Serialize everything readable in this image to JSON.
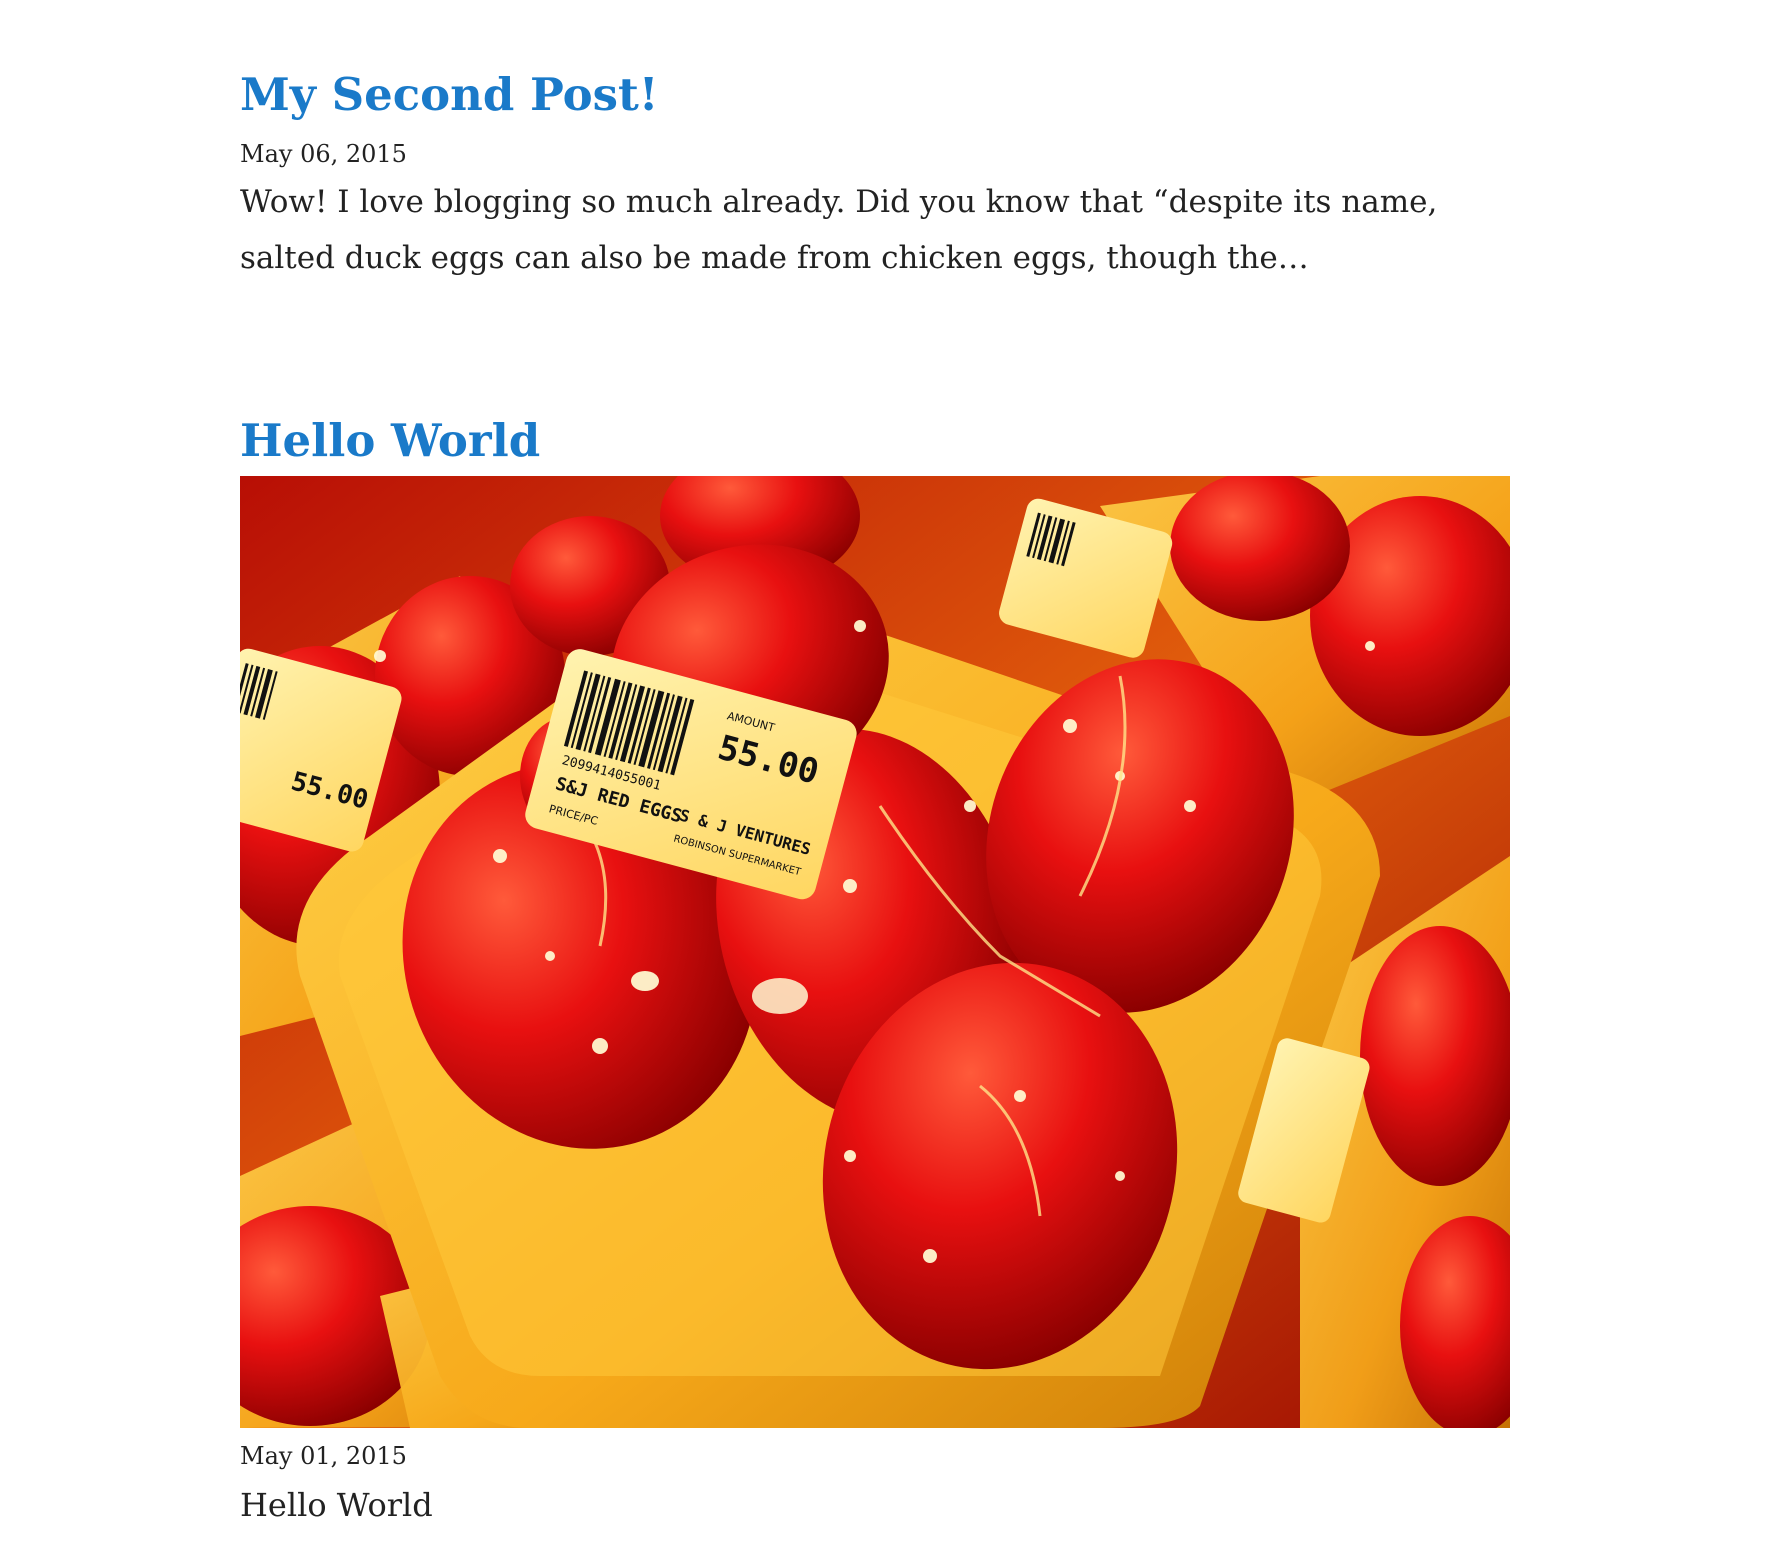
{
  "posts": [
    {
      "title": "My Second Post!",
      "date": "May 06, 2015",
      "excerpt": "Wow! I love blogging so much already. Did you know that “despite its name, salted duck eggs can also be made from chicken eggs, though the…"
    },
    {
      "title": "Hello World",
      "date": "May 01, 2015",
      "body": "Hello World",
      "image": {
        "label_brand": "S&J RED EGGS",
        "label_price": "55.00",
        "label_amount": "AMOUNT",
        "label_price_per": "PRICE/PC",
        "label_vendor": "S & J VENTURES",
        "label_store": "ROBINSON SUPERMARKET",
        "label_barcode": "2099414055001"
      }
    }
  ],
  "colors": {
    "link": "#1a7ac9",
    "text": "#222222"
  }
}
